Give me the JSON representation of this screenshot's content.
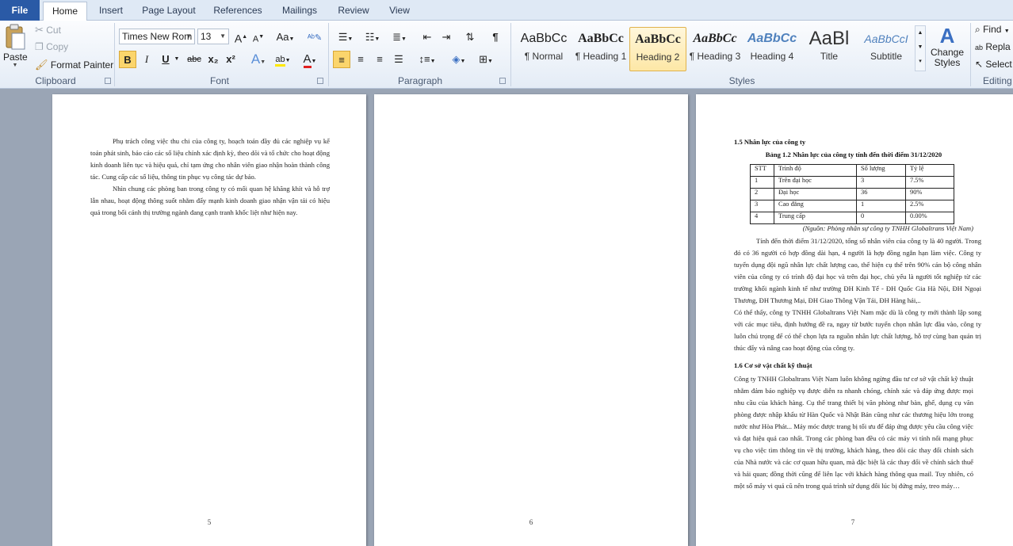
{
  "tabs": {
    "file": "File",
    "home": "Home",
    "insert": "Insert",
    "page_layout": "Page Layout",
    "references": "References",
    "mailings": "Mailings",
    "review": "Review",
    "view": "View"
  },
  "clipboard": {
    "paste": "Paste",
    "cut": "Cut",
    "copy": "Copy",
    "format_painter": "Format Painter",
    "label": "Clipboard"
  },
  "font": {
    "name": "Times New Rom",
    "size": "13",
    "label": "Font",
    "bold": "B",
    "italic": "I",
    "underline": "U",
    "strike": "abc",
    "sub": "x₂",
    "sup": "x²",
    "case": "Aa",
    "grow": "A",
    "shrink": "A"
  },
  "paragraph": {
    "label": "Paragraph"
  },
  "styles": {
    "label": "Styles",
    "items": [
      {
        "sample": "AaBbCc",
        "name": "¶ Normal"
      },
      {
        "sample": "AaBbCc",
        "name": "¶ Heading 1"
      },
      {
        "sample": "AaBbCc",
        "name": "Heading 2"
      },
      {
        "sample": "AaBbCc",
        "name": "¶ Heading 3"
      },
      {
        "sample": "AaBbCc",
        "name": "Heading 4"
      },
      {
        "sample": "AaBl",
        "name": "Title"
      },
      {
        "sample": "AaBbCcI",
        "name": "Subtitle"
      }
    ],
    "change_styles": "Change Styles"
  },
  "editing": {
    "label": "Editing",
    "find": "Find",
    "replace": "Repla",
    "select": "Select"
  },
  "page5": {
    "paragraphs": [
      "Phụ trách công việc thu chi của công ty, hoạch toán đầy đủ các nghiệp vụ kế toán phát sinh, báo cáo các số liệu chính xác định kỳ, theo dõi và tổ chức cho hoạt động kinh doanh liên tục và hiệu quả, chỉ tạm ứng cho nhân viên giao nhận hoàn thành công tác. Cung cấp các số liệu, thông tin phục vụ công tác dự báo.",
      "Nhìn chung các phòng ban trong công ty có mối quan hệ khăng khít và hỗ trợ lẫn nhau, hoạt động thông suốt nhằm đẩy mạnh kinh doanh giao nhận vận tải có hiệu quả trong bối cảnh thị trường ngành đang cạnh tranh khốc liệt như hiện nay."
    ],
    "number": "5"
  },
  "page6": {
    "number": "6"
  },
  "page7": {
    "heading1": "1.5 Nhân lực của công ty",
    "table_title": "Bảng 1.2 Nhân lực của công ty tính đến thời điểm 31/12/2020",
    "table_header": [
      "STT",
      "Trình độ",
      "Số lượng",
      "Tỷ lệ"
    ],
    "table_rows": [
      [
        "1",
        "Trên đại học",
        "3",
        "7.5%"
      ],
      [
        "2",
        "Đại học",
        "36",
        "90%"
      ],
      [
        "3",
        "Cao đẳng",
        "1",
        "2.5%"
      ],
      [
        "4",
        "Trung cấp",
        "0",
        "0.00%"
      ]
    ],
    "source": "(Nguồn: Phòng nhân sự công ty TNHH Globaltrans Việt Nam)",
    "para1": "Tính đến thời điểm 31/12/2020, tổng số nhân viên của công ty là 40 người. Trong đó có 36 người có hợp đồng dài hạn, 4 người là hợp đồng ngắn hạn làm việc. Công ty tuyển dụng đội ngũ nhân lực chất lượng cao, thể hiện cụ thể trên 90% cán bộ công nhân viên của công ty có trình độ đại học và trên đại học, chủ yếu là người tốt nghiệp từ các trường khối ngành kinh tế như trường ĐH Kinh Tế - ĐH Quốc Gia Hà Nội, ĐH Ngoại Thương, ĐH Thương Mại, ĐH Giao Thông Vận Tải, ĐH Hàng hải,..",
    "para2": "Có thể thấy, công ty TNHH Globaltrans Việt Nam mặc dù là công ty mới thành lập song với các mục tiêu, định hướng đề ra, ngay từ bước tuyển chọn nhân lực đầu vào, công ty luôn chú trọng để có thể chọn lựa ra nguồn nhân lực chất lượng, hỗ trợ cùng ban quản trị thúc đẩy và nâng cao hoạt động của công ty.",
    "heading2": "1.6 Cơ sở vật chất kỹ thuật",
    "para3": "Công ty TNHH Globaltrans Việt Nam luôn không ngừng đầu tư cơ sở vật chất kỹ thuật nhằm đảm bảo nghiệp vụ được diễn ra nhanh chóng, chính xác và đáp ứng được mọi nhu cầu của khách hàng. Cụ thể trang thiết bị văn phòng như bàn, ghế, dụng cụ văn phòng được nhập khẩu từ Hàn Quốc và Nhật Bản cũng như các thương hiệu lớn trong nước như Hòa Phát... Máy móc được trang bị tối ưu để đáp ứng được yêu cầu công việc và đạt hiệu quả cao nhất. Trong các phòng ban đều có các máy vi tính nối mạng phục vụ cho việc tìm thông tin về thị trường, khách hàng, theo dõi các thay đổi chính sách của Nhà nước và các cơ quan hữu quan, mà đặc biệt là các thay đổi về chính sách thuế và hải quan; đồng thời cũng để liên lạc với khách hàng thông qua mail. Tuy nhiên, có một số máy vi quá cũ nên trong quá trình sử dụng đôi lúc bị đứng máy, treo máy…",
    "number": "7"
  }
}
